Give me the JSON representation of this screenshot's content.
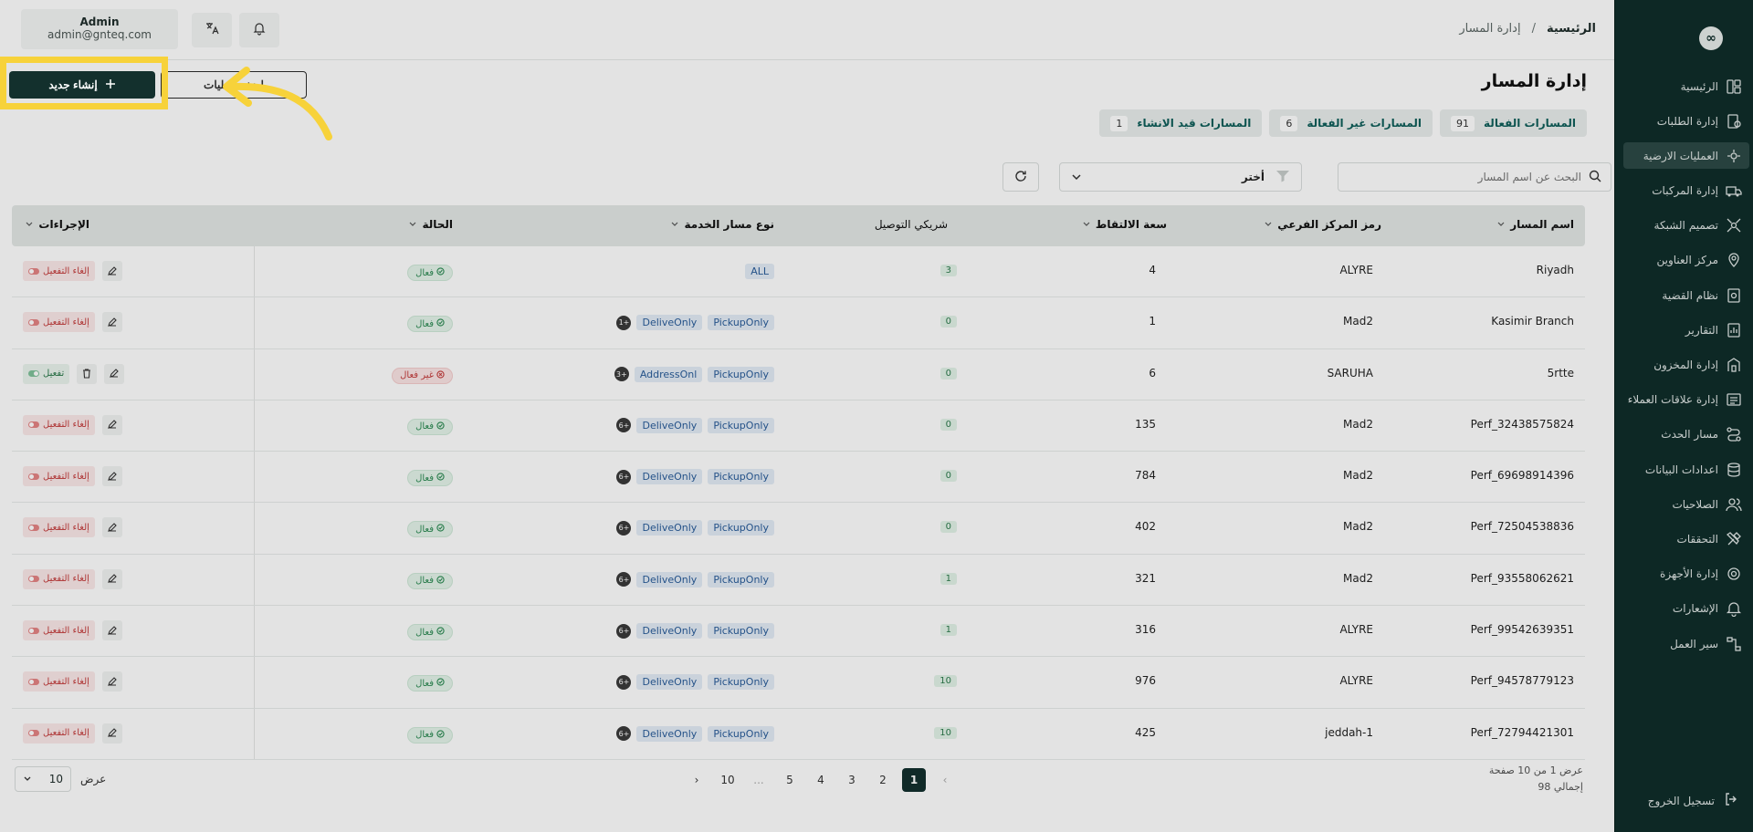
{
  "sidebar": {
    "logo": "∞",
    "items": [
      {
        "label": "الرئيسية",
        "icon": "dashboard-icon"
      },
      {
        "label": "إدارة الطلبات",
        "icon": "orders-icon"
      },
      {
        "label": "العمليات الارضية",
        "icon": "ground-ops-icon",
        "active": true
      },
      {
        "label": "إدارة المركبات",
        "icon": "truck-icon"
      },
      {
        "label": "تصميم الشبكة",
        "icon": "network-icon"
      },
      {
        "label": "مركز العناوين",
        "icon": "location-icon"
      },
      {
        "label": "نظام القضية",
        "icon": "case-icon"
      },
      {
        "label": "التقارير",
        "icon": "reports-icon"
      },
      {
        "label": "إدارة المخزون",
        "icon": "inventory-icon"
      },
      {
        "label": "إدارة علاقات العملاء",
        "icon": "crm-icon"
      },
      {
        "label": "مسار الحدث",
        "icon": "route-icon"
      },
      {
        "label": "اعدادات البيانات",
        "icon": "database-icon"
      },
      {
        "label": "الصلاحيات",
        "icon": "users-icon"
      },
      {
        "label": "التحققات",
        "icon": "tools-icon"
      },
      {
        "label": "إدارة الأجهزة",
        "icon": "device-icon"
      },
      {
        "label": "الإشعارات",
        "icon": "bell-icon"
      },
      {
        "label": "سير العمل",
        "icon": "workflow-icon"
      }
    ],
    "logout_label": "تسجيل الخروج"
  },
  "header": {
    "breadcrumb_home": "الرئيسية",
    "breadcrumb_sep": "/",
    "breadcrumb_current": "إدارة المسار",
    "user_name": "Admin",
    "user_email": "admin@gnteq.com"
  },
  "page": {
    "title": "إدارة المسار",
    "create_label": "إنشاء جديد",
    "ops_label": "اضف عمليات"
  },
  "tabs": [
    {
      "label": "المسارات الفعالة",
      "count": "91"
    },
    {
      "label": "المسارات غير الفعالة",
      "count": "6"
    },
    {
      "label": "المسارات قيد الانشاء",
      "count": "1"
    }
  ],
  "toolbar": {
    "search_placeholder": "البحث عن اسم المسار",
    "filter_label": "أختر"
  },
  "table": {
    "headers": {
      "route_name": "اسم المسار",
      "branch_code": "رمز المركز الفرعي",
      "pickup_capacity": "سعة الالتقاط",
      "delivery_partner": "شريكي التوصيل",
      "service_type": "نوع مسار الخدمة",
      "status": "الحالة",
      "actions": "الإجراءات"
    },
    "rows": [
      {
        "name": "Riyadh",
        "branch": "ALYRE",
        "capacity": "4",
        "partners": "3",
        "services": [
          "ALL"
        ],
        "more": "",
        "status": "فعال",
        "active": true,
        "action": "إلغاء التفعيل"
      },
      {
        "name": "Kasimir Branch",
        "branch": "Mad2",
        "capacity": "1",
        "partners": "0",
        "services": [
          "PickupOnly",
          "DeliveOnly"
        ],
        "more": "1+",
        "status": "فعال",
        "active": true,
        "action": "إلغاء التفعيل"
      },
      {
        "name": "5rtte",
        "branch": "SARUHA",
        "capacity": "6",
        "partners": "0",
        "services": [
          "PickupOnly",
          "AddressOnl"
        ],
        "more": "3+",
        "status": "غير فعال",
        "active": false,
        "action": "تفعيل"
      },
      {
        "name": "Perf_32438575824",
        "branch": "Mad2",
        "capacity": "135",
        "partners": "0",
        "services": [
          "PickupOnly",
          "DeliveOnly"
        ],
        "more": "6+",
        "status": "فعال",
        "active": true,
        "action": "إلغاء التفعيل"
      },
      {
        "name": "Perf_69698914396",
        "branch": "Mad2",
        "capacity": "784",
        "partners": "0",
        "services": [
          "PickupOnly",
          "DeliveOnly"
        ],
        "more": "6+",
        "status": "فعال",
        "active": true,
        "action": "إلغاء التفعيل"
      },
      {
        "name": "Perf_72504538836",
        "branch": "Mad2",
        "capacity": "402",
        "partners": "0",
        "services": [
          "PickupOnly",
          "DeliveOnly"
        ],
        "more": "6+",
        "status": "فعال",
        "active": true,
        "action": "إلغاء التفعيل"
      },
      {
        "name": "Perf_93558062621",
        "branch": "Mad2",
        "capacity": "321",
        "partners": "1",
        "services": [
          "PickupOnly",
          "DeliveOnly"
        ],
        "more": "6+",
        "status": "فعال",
        "active": true,
        "action": "إلغاء التفعيل"
      },
      {
        "name": "Perf_99542639351",
        "branch": "ALYRE",
        "capacity": "316",
        "partners": "1",
        "services": [
          "PickupOnly",
          "DeliveOnly"
        ],
        "more": "6+",
        "status": "فعال",
        "active": true,
        "action": "إلغاء التفعيل"
      },
      {
        "name": "Perf_94578779123",
        "branch": "ALYRE",
        "capacity": "976",
        "partners": "10",
        "services": [
          "PickupOnly",
          "DeliveOnly"
        ],
        "more": "6+",
        "status": "فعال",
        "active": true,
        "action": "إلغاء التفعيل"
      },
      {
        "name": "Perf_72794421301",
        "branch": "jeddah-1",
        "capacity": "425",
        "partners": "10",
        "services": [
          "PickupOnly",
          "DeliveOnly"
        ],
        "more": "6+",
        "status": "فعال",
        "active": true,
        "action": "إلغاء التفعيل"
      }
    ]
  },
  "footer": {
    "page_info": "عرض 1 من 10 صفحة",
    "total_info": "إجمالي 98",
    "pages": [
      "1",
      "2",
      "3",
      "4",
      "5",
      "...",
      "10"
    ],
    "current_page": "1",
    "prev": "‹",
    "next": "›",
    "page_size_label": "عرض",
    "page_size": "10"
  },
  "colors": {
    "sidebar_bg": "#0f2d2a",
    "primary": "#13302d",
    "highlight": "#f7d23a",
    "active_green": "#2b8a52",
    "inactive_red": "#c43b3b"
  }
}
